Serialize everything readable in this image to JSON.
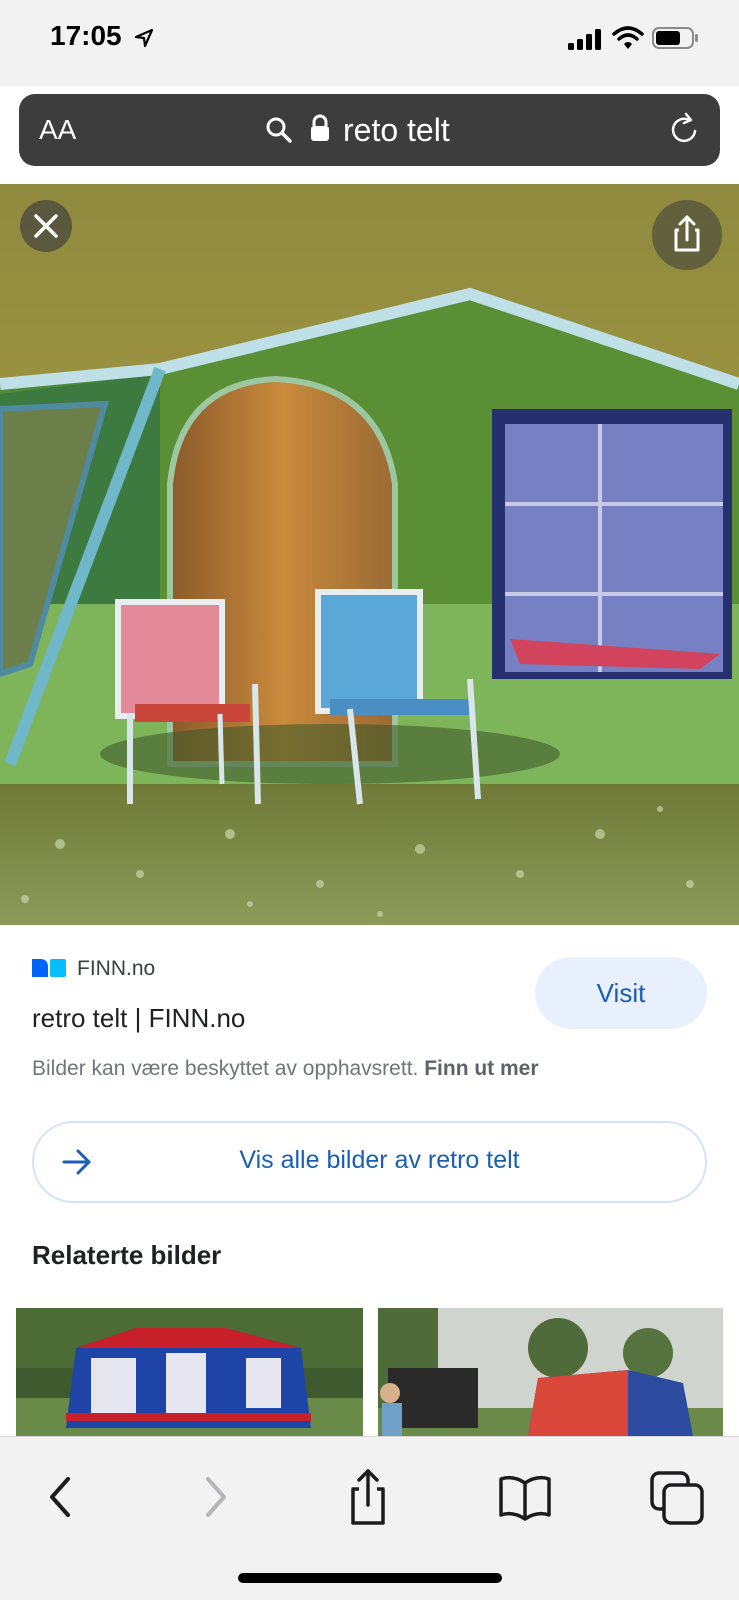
{
  "status_bar": {
    "time": "17:05",
    "icons": [
      "location-arrow-icon",
      "cell-signal-icon",
      "wifi-icon",
      "battery-icon"
    ]
  },
  "address_bar": {
    "text_size_label": "AA",
    "url_text": "reto telt",
    "icons": [
      "search-icon",
      "lock-icon",
      "reload-icon"
    ]
  },
  "image_viewer": {
    "close_icon": "close-icon",
    "share_icon": "share-icon",
    "image_subject": "green retro tent with two folding chairs"
  },
  "result": {
    "source_name": "FINN.no",
    "title": "retro telt | FINN.no",
    "visit_label": "Visit",
    "copyright_text": "Bilder kan være beskyttet av opphavsrett.",
    "copyright_link": "Finn ut mer",
    "see_all_label": "Vis alle bilder av retro telt",
    "brand_colors": {
      "finn_dark": "#0063fb",
      "finn_light": "#06befb",
      "link_blue": "#1a5fb4"
    }
  },
  "related": {
    "heading": "Relaterte bilder",
    "thumbnails": [
      "red and blue retro tent in forest",
      "red and blue tent at campsite with car"
    ]
  },
  "toolbar": {
    "buttons": [
      "back-icon",
      "forward-icon",
      "share-icon",
      "bookmarks-icon",
      "tabs-icon"
    ]
  }
}
